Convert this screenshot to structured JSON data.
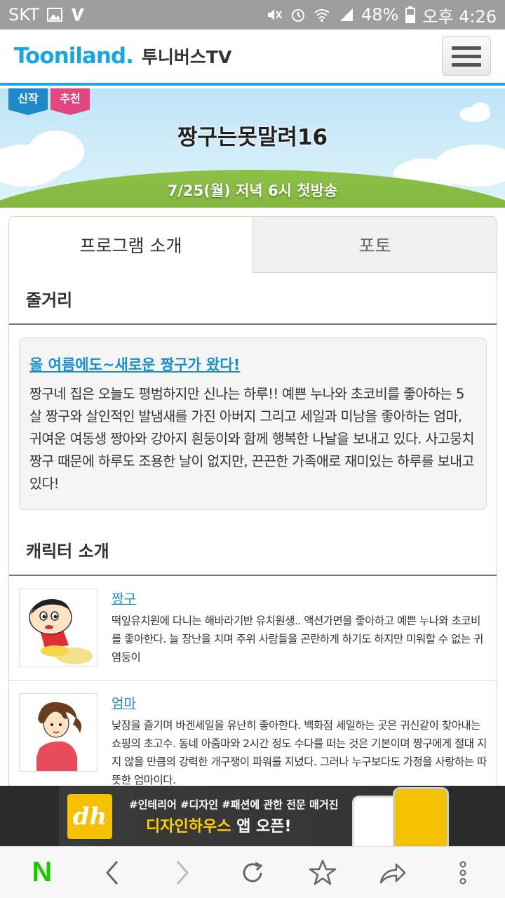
{
  "status_bar": {
    "carrier": "SKT",
    "battery": "48%",
    "time": "오후 4:26"
  },
  "header": {
    "logo": "Tooniland.",
    "site_title": "투니버스TV"
  },
  "banner": {
    "tag_new": "신작",
    "tag_recommend": "추천",
    "title": "짱구는못말려16",
    "airdate": "7/25(월) 저녁 6시 첫방송"
  },
  "tabs": [
    {
      "label": "프로그램 소개",
      "active": true
    },
    {
      "label": "포토",
      "active": false
    }
  ],
  "synopsis": {
    "heading": "줄거리",
    "title": "올 여름에도~새로운 짱구가 왔다!",
    "body": "짱구네 집은 오늘도 평범하지만 신나는 하루!! 예쁜 누나와 초코비를 좋아하는 5살 짱구와 살인적인 발냄새를 가진 아버지 그리고 세일과 미남을 좋아하는 엄마, 귀여운 여동생 짱아와 강아지 흰둥이와 함께 행복한 나날을 보내고 있다. 사고뭉치 짱구 때문에 하루도 조용한 날이 없지만, 끈끈한 가족애로 재미있는 하루를 보내고 있다!"
  },
  "characters": {
    "heading": "캐릭터 소개",
    "items": [
      {
        "name": "짱구",
        "description": "떡잎유치원에 다니는 해바라기반 유치원생.. 액션가면을 좋아하고 예쁜 누나와 초코비를 좋아한다. 늘 장난을 치며 주위 사람들을 곤란하게 하기도 하지만 미워할 수 없는 귀염둥이"
      },
      {
        "name": "엄마",
        "description": "낮잠을 즐기며 바겐세일을 유난히 좋아한다. 백화점 세일하는 곳은 귀신같이 찾아내는 쇼핑의 초고수. 동네 아줌마와 2시간 정도 수다를 떠는 것은 기본이며 짱구에게 절대 지지 않을 만큼의 강력한 개구쟁이 파워를 지녔다. 그러나 누구보다도 가정을 사랑하는 따뜻한 엄마이다."
      }
    ]
  },
  "ad": {
    "logo": "dh",
    "line1": "#인테리어 #디자인 #패션에 관한 전문 매거진",
    "line2_brand": "디자인하우스",
    "line2_rest": " 앱 오픈!"
  },
  "bottom_nav": {
    "naver_label": "N"
  },
  "colors": {
    "accent_blue": "#1aa6e0",
    "link_blue": "#1a8fc9",
    "tag_blue": "#1e88c8",
    "tag_pink": "#e2457f",
    "hill_green": "#7ab23a",
    "naver_green": "#1ec800"
  }
}
